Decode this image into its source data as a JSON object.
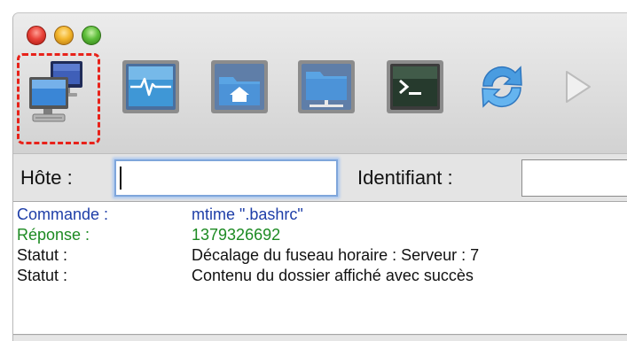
{
  "toolbar": {
    "buttons": [
      {
        "icon": "site-manager-icon",
        "highlighted": true
      },
      {
        "icon": "activity-monitor-icon"
      },
      {
        "icon": "local-folder-icon"
      },
      {
        "icon": "network-folder-icon"
      },
      {
        "icon": "terminal-icon"
      },
      {
        "icon": "refresh-icon"
      },
      {
        "icon": "play-icon"
      }
    ],
    "highlight_color": "#e8221a"
  },
  "quickconnect": {
    "host_label": "Hôte :",
    "host_value": "",
    "identifiant_label": "Identifiant :",
    "identifiant_value": ""
  },
  "log": [
    {
      "type": "Commande :",
      "message": "mtime \".bashrc\"",
      "color": "#1e3ea8"
    },
    {
      "type": "Réponse :",
      "message": "1379326692",
      "color": "#1c8a22"
    },
    {
      "type": "Statut :",
      "message": "Décalage du fuseau horaire : Serveur : 7",
      "color": "#111111"
    },
    {
      "type": "Statut :",
      "message": "Contenu du dossier affiché avec succès",
      "color": "#111111"
    }
  ]
}
